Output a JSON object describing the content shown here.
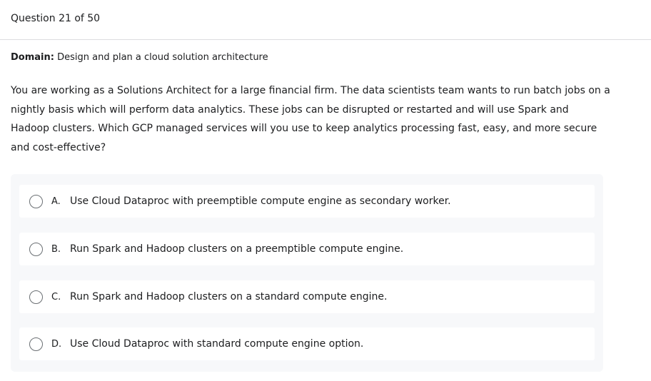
{
  "header": {
    "counter": "Question 21 of 50"
  },
  "domain": {
    "label": "Domain:",
    "value": "Design and plan a cloud solution architecture"
  },
  "question": {
    "text": "You are working as a Solutions Architect for a large financial firm. The data scientists team wants to run batch jobs on a nightly basis which will perform data analytics. These jobs can be disrupted or restarted and will use Spark and Hadoop clusters. Which GCP managed services will you use to keep analytics processing fast, easy, and more secure and cost-effective?"
  },
  "options": [
    {
      "letter": "A.",
      "text": "Use Cloud Dataproc with preemptible compute engine as secondary worker."
    },
    {
      "letter": "B.",
      "text": "Run Spark and Hadoop clusters on a preemptible compute engine."
    },
    {
      "letter": "C.",
      "text": "Run Spark and Hadoop clusters on a standard compute engine."
    },
    {
      "letter": "D.",
      "text": "Use Cloud Dataproc with standard compute engine option."
    }
  ]
}
